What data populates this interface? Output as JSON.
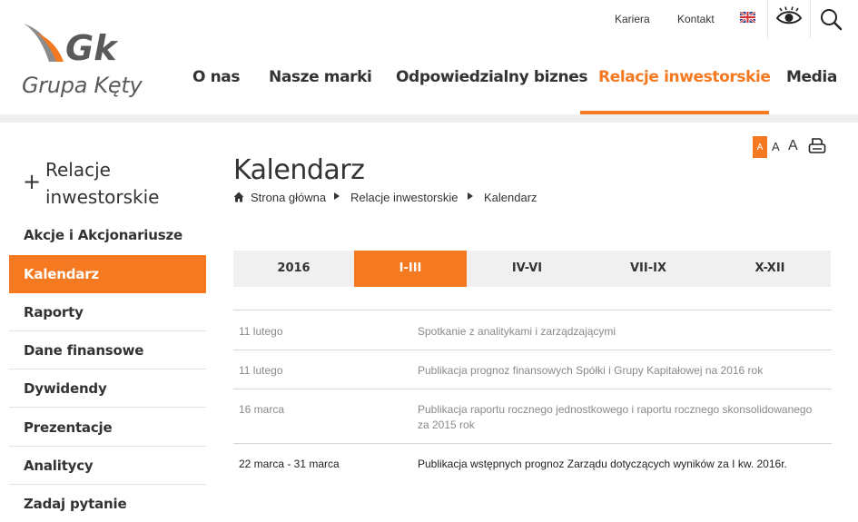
{
  "header": {
    "logo_mark": "Gk",
    "logo_text": "Grupa Kęty",
    "utility_links": [
      "Kariera",
      "Kontakt"
    ],
    "language_icon": "uk-flag-icon",
    "accessibility_icon": "eye-icon",
    "search_icon": "search-icon",
    "nav": [
      "O nas",
      "Nasze marki",
      "Odpowiedzialny biznes",
      "Relacje inwestorskie",
      "Media"
    ],
    "active_nav": "Relacje inwestorskie"
  },
  "sidebar": {
    "title": "Relacje inwestorskie",
    "items": [
      "Akcje i Akcjonariusze",
      "Kalendarz",
      "Raporty",
      "Dane finansowe",
      "Dywidendy",
      "Prezentacje",
      "Analitycy",
      "Zadaj pytanie"
    ],
    "active_item": "Kalendarz"
  },
  "tools": {
    "font_small": "A",
    "font_medium": "A",
    "font_large": "A",
    "print_icon": "print-icon"
  },
  "main": {
    "title": "Kalendarz",
    "breadcrumb": [
      "Strona główna",
      "Relacje inwestorskie",
      "Kalendarz"
    ],
    "tabs": [
      "2016",
      "I-III",
      "IV-VI",
      "VII-IX",
      "X-XII"
    ],
    "active_tab": "I-III",
    "events": [
      {
        "date": "11 lutego",
        "description": "Spotkanie z analitykami i zarządzającymi"
      },
      {
        "date": "11 lutego",
        "description": "Publikacja prognoz finansowych Spółki i Grupy Kapitałowej na 2016 rok"
      },
      {
        "date": "16 marca",
        "description": "Publikacja raportu rocznego jednostkowego i raportu rocznego skonsolidowanego za 2015 rok"
      },
      {
        "date": "22 marca - 31 marca",
        "description": "Publikacja wstępnych prognoz Zarządu dotyczących wyników za I kw. 2016r."
      }
    ]
  },
  "colors": {
    "accent": "#f47920",
    "text": "#333333",
    "muted": "#8a8a8a",
    "band": "#efefef"
  }
}
